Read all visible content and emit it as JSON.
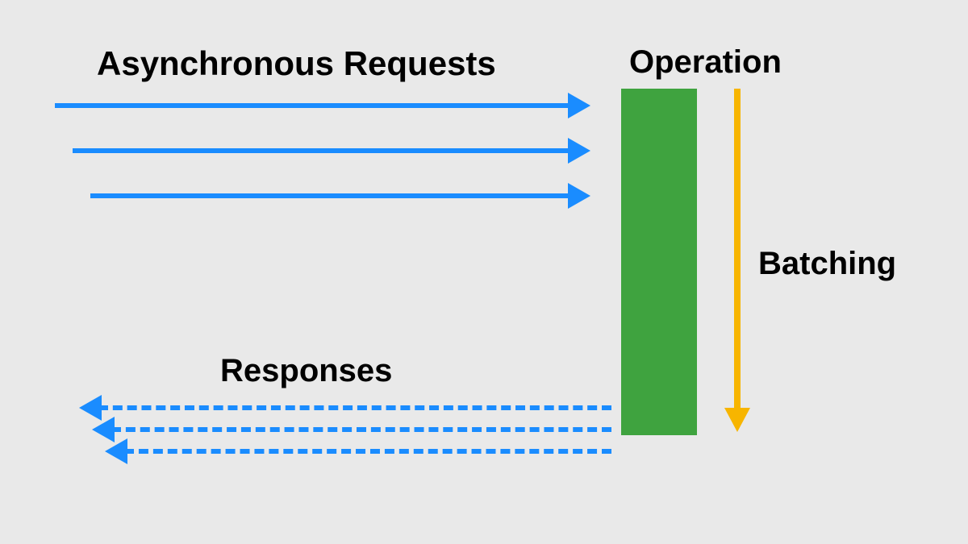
{
  "labels": {
    "requests": "Asynchronous Requests",
    "operation": "Operation",
    "batching": "Batching",
    "responses": "Responses"
  },
  "colors": {
    "request_arrow": "#1a8cff",
    "response_arrow": "#1a8cff",
    "batch_arrow": "#f7b500",
    "operation_box": "#3fa33f",
    "background": "#e9e9e9"
  },
  "counts": {
    "request_arrows": 3,
    "response_arrows": 3
  }
}
